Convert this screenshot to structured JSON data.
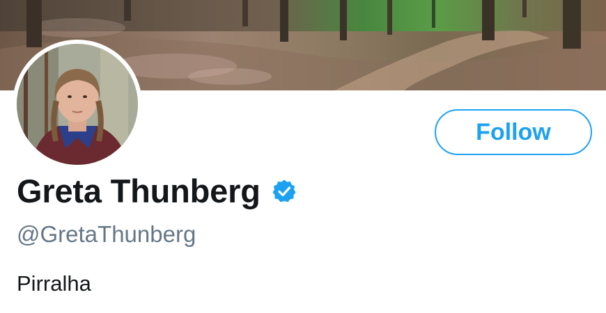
{
  "profile": {
    "display_name": "Greta Thunberg",
    "handle": "@GretaThunberg",
    "bio": "Pirralha",
    "verified": true
  },
  "actions": {
    "follow_label": "Follow"
  },
  "colors": {
    "accent": "#1da1f2",
    "name_text": "#14171a",
    "handle_text": "#657786",
    "background": "#ffffff"
  },
  "icons": {
    "verified": "verified-badge-icon"
  }
}
